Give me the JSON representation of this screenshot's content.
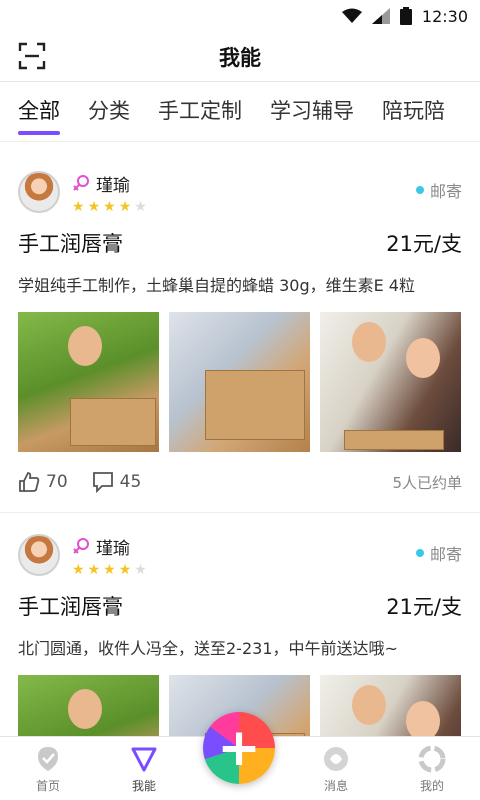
{
  "status_bar": {
    "time": "12:30"
  },
  "header": {
    "title": "我能"
  },
  "tabs": [
    {
      "label": "全部"
    },
    {
      "label": "分类"
    },
    {
      "label": "手工定制"
    },
    {
      "label": "学习辅导"
    },
    {
      "label": "陪玩陪"
    }
  ],
  "posts": [
    {
      "user": "瑾瑜",
      "rating": 4,
      "delivery": "邮寄",
      "title": "手工润唇膏",
      "price": "21元/支",
      "description": "学姐纯手工制作，土蜂巢自提的蜂蜡 30g，维生素E 4粒",
      "likes": "70",
      "comments": "45",
      "orders": "5人已约单"
    },
    {
      "user": "瑾瑜",
      "rating": 4,
      "delivery": "邮寄",
      "title": "手工润唇膏",
      "price": "21元/支",
      "description": "北门圆通，收件人冯全，送至2-231，中午前送达哦~"
    }
  ],
  "bottom_nav": [
    {
      "label": "首页",
      "icon": "home-pin-icon"
    },
    {
      "label": "我能",
      "icon": "triangle-icon"
    },
    {
      "label": "消息",
      "icon": "message-icon"
    },
    {
      "label": "我的",
      "icon": "profile-ring-icon"
    }
  ],
  "colors": {
    "accent": "#7a4dff",
    "star": "#f5c322",
    "delivery_dot": "#39c8e6"
  }
}
